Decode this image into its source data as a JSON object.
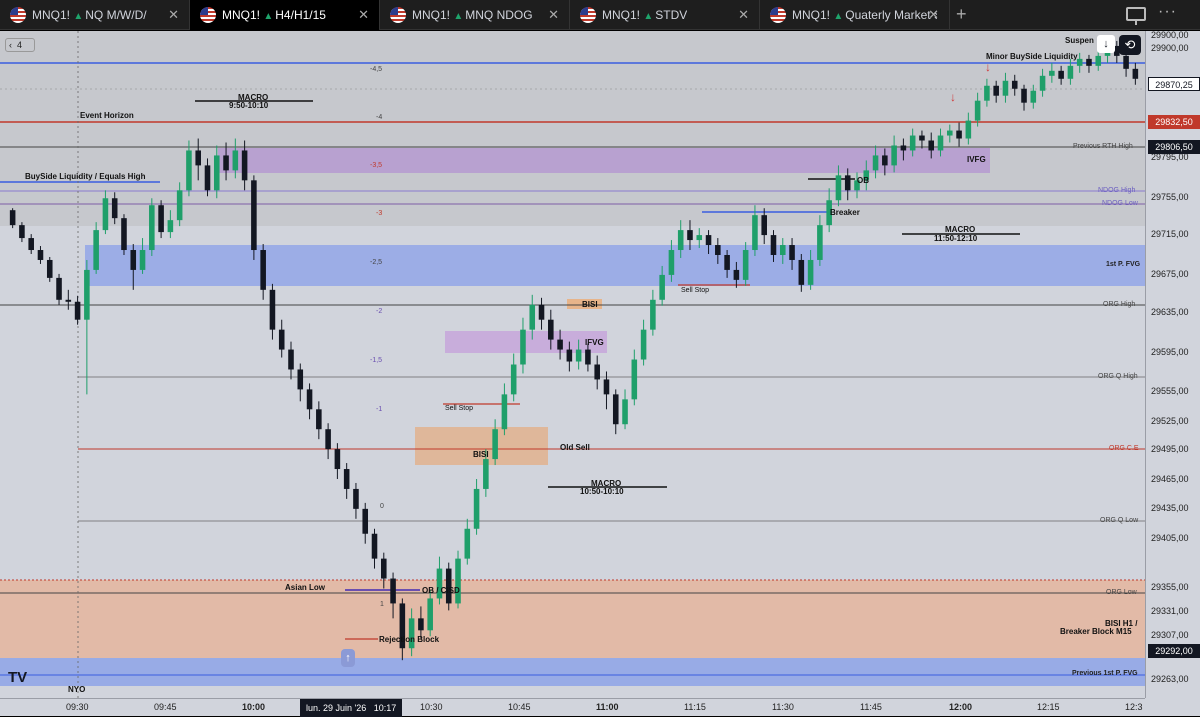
{
  "tabs": [
    {
      "symbol": "MNQ1!",
      "name": "NQ M/W/D/",
      "active": false
    },
    {
      "symbol": "MNQ1!",
      "name": "H4/H1/15",
      "active": true
    },
    {
      "symbol": "MNQ1!",
      "name": "MNQ NDOG",
      "active": false
    },
    {
      "symbol": "MNQ1!",
      "name": "STDV",
      "active": false
    },
    {
      "symbol": "MNQ1!",
      "name": "Quaterly Market S",
      "active": false
    }
  ],
  "toolbar": {
    "zoom_value": "4",
    "suspend_label": "Suspen"
  },
  "price_axis": {
    "ticks": [
      "29900,00",
      "29795,00",
      "29755,00",
      "29715,00",
      "29675,00",
      "29635,00",
      "29595,00",
      "29555,00",
      "29525,00",
      "29495,00",
      "29465,00",
      "29435,00",
      "29405,00",
      "29355,00",
      "29331,00",
      "29307,00",
      "29263,00"
    ],
    "current_price": "29870,25",
    "red_tag": "29832,50",
    "dark_tag": "29806,50",
    "bottom_tag": "29292,00"
  },
  "time_axis": {
    "labels": [
      "09:30",
      "09:45",
      "10:00",
      "10:30",
      "10:45",
      "11:00",
      "11:15",
      "11:30",
      "11:45",
      "12:00",
      "12:15",
      "12:3"
    ],
    "date_label": "lun. 29 Juin '26",
    "time_label": "10:17"
  },
  "annotations": {
    "macro1_title": "MACRO",
    "macro1_time": "9:50-10:10",
    "macro2_title": "MACRO",
    "macro2_time": "11:50-12:10",
    "macro3_title": "MACRO",
    "macro3_time": "10:50-10:10",
    "event_horizon": "Event Horizon",
    "buyside": "BuySide Liquidity / Equals High",
    "minor_buyside": "Minor BuySide Liquidity",
    "ivfg": "IVFG",
    "ob": "OB",
    "breaker": "Breaker",
    "sell_stop_1": "Sell Stop",
    "sell_stop_2": "Sell Stop",
    "bisi_1": "BISI",
    "bisi_2": "BISI",
    "ifvg": "IFVG",
    "old_sell": "Old Sell",
    "asian_low": "Asian Low",
    "ob_cisd": "OB / CISD",
    "rejection_block": "Rejection Block",
    "bisi_h1_1": "BISI H1 /",
    "bisi_h1_2": "Breaker Block M15",
    "nyo": "NYO"
  },
  "levels": {
    "prev_rth_high": "Previous RTH High",
    "ndog_high": "NDOG High",
    "ndog_low": "NDOG Low",
    "first_fvg": "1st P. FVG",
    "org_high": "ORG  High",
    "org_q_high": "ORG Q High",
    "org_ce": "ORG C.E",
    "org_q_low": "ORG Q Low",
    "org_low": "ORG Low",
    "prev_first_fvg": "Previous 1st P. FVG"
  },
  "fib": [
    "-4,5",
    "-4",
    "-3,5",
    "-3",
    "-2,5",
    "-2",
    "-1,5",
    "-1",
    "0",
    "1"
  ],
  "colors": {
    "bg": "#d1d4dc",
    "up": "#1f9f6a",
    "down": "#131722",
    "purple_zone": "#b59ad0",
    "blue_zone": "#8ea3e8",
    "orange_zone": "#e7b48a",
    "red_line": "#c0392b",
    "blue_line": "#3a5ee0"
  },
  "candles": [
    [
      29740,
      29725,
      29742,
      29722
    ],
    [
      29725,
      29712,
      29728,
      29708
    ],
    [
      29712,
      29700,
      29716,
      29696
    ],
    [
      29700,
      29690,
      29704,
      29686
    ],
    [
      29690,
      29672,
      29693,
      29668
    ],
    [
      29672,
      29650,
      29676,
      29645
    ],
    [
      29650,
      29648,
      29660,
      29640
    ],
    [
      29648,
      29630,
      29654,
      29625
    ],
    [
      29630,
      29680,
      29690,
      29555
    ],
    [
      29680,
      29720,
      29728,
      29676
    ],
    [
      29720,
      29752,
      29760,
      29716
    ],
    [
      29752,
      29732,
      29758,
      29726
    ],
    [
      29732,
      29700,
      29736,
      29695
    ],
    [
      29700,
      29680,
      29706,
      29660
    ],
    [
      29680,
      29700,
      29712,
      29676
    ],
    [
      29700,
      29745,
      29752,
      29694
    ],
    [
      29745,
      29718,
      29750,
      29712
    ],
    [
      29718,
      29730,
      29740,
      29712
    ],
    [
      29730,
      29760,
      29768,
      29724
    ],
    [
      29760,
      29800,
      29810,
      29754
    ],
    [
      29800,
      29785,
      29812,
      29770
    ],
    [
      29785,
      29760,
      29792,
      29754
    ],
    [
      29760,
      29795,
      29805,
      29752
    ],
    [
      29795,
      29780,
      29808,
      29770
    ],
    [
      29780,
      29800,
      29812,
      29772
    ],
    [
      29800,
      29770,
      29810,
      29760
    ],
    [
      29770,
      29700,
      29775,
      29690
    ],
    [
      29700,
      29660,
      29706,
      29650
    ],
    [
      29660,
      29620,
      29666,
      29610
    ],
    [
      29620,
      29600,
      29630,
      29592
    ],
    [
      29600,
      29580,
      29608,
      29570
    ],
    [
      29580,
      29560,
      29586,
      29548
    ],
    [
      29560,
      29540,
      29566,
      29530
    ],
    [
      29540,
      29520,
      29548,
      29510
    ],
    [
      29520,
      29500,
      29526,
      29490
    ],
    [
      29500,
      29480,
      29506,
      29470
    ],
    [
      29480,
      29460,
      29486,
      29450
    ],
    [
      29460,
      29440,
      29466,
      29430
    ],
    [
      29440,
      29415,
      29446,
      29405
    ],
    [
      29415,
      29390,
      29420,
      29380
    ],
    [
      29390,
      29370,
      29396,
      29360
    ],
    [
      29370,
      29345,
      29376,
      29330
    ],
    [
      29345,
      29300,
      29350,
      29288
    ],
    [
      29300,
      29330,
      29340,
      29292
    ],
    [
      29330,
      29318,
      29342,
      29310
    ],
    [
      29318,
      29350,
      29358,
      29312
    ],
    [
      29350,
      29380,
      29392,
      29344
    ],
    [
      29380,
      29345,
      29386,
      29338
    ],
    [
      29345,
      29390,
      29398,
      29340
    ],
    [
      29390,
      29420,
      29430,
      29384
    ],
    [
      29420,
      29460,
      29470,
      29414
    ],
    [
      29460,
      29490,
      29500,
      29452
    ],
    [
      29490,
      29520,
      29530,
      29484
    ],
    [
      29520,
      29555,
      29566,
      29514
    ],
    [
      29555,
      29585,
      29596,
      29548
    ],
    [
      29585,
      29620,
      29632,
      29576
    ],
    [
      29620,
      29645,
      29655,
      29610
    ],
    [
      29645,
      29630,
      29652,
      29620
    ],
    [
      29630,
      29610,
      29640,
      29600
    ],
    [
      29610,
      29600,
      29620,
      29590
    ],
    [
      29600,
      29588,
      29608,
      29578
    ],
    [
      29588,
      29600,
      29610,
      29580
    ],
    [
      29600,
      29585,
      29606,
      29578
    ],
    [
      29585,
      29570,
      29594,
      29560
    ],
    [
      29570,
      29555,
      29578,
      29540
    ],
    [
      29555,
      29525,
      29560,
      29515
    ],
    [
      29525,
      29550,
      29560,
      29520
    ],
    [
      29550,
      29590,
      29600,
      29544
    ],
    [
      29590,
      29620,
      29630,
      29584
    ],
    [
      29620,
      29650,
      29660,
      29614
    ],
    [
      29650,
      29675,
      29684,
      29644
    ],
    [
      29675,
      29700,
      29710,
      29668
    ],
    [
      29700,
      29720,
      29730,
      29692
    ],
    [
      29720,
      29710,
      29730,
      29700
    ],
    [
      29710,
      29715,
      29722,
      29702
    ],
    [
      29715,
      29705,
      29720,
      29696
    ],
    [
      29705,
      29695,
      29712,
      29686
    ],
    [
      29695,
      29680,
      29700,
      29672
    ],
    [
      29680,
      29670,
      29688,
      29662
    ],
    [
      29670,
      29700,
      29708,
      29664
    ],
    [
      29700,
      29735,
      29745,
      29694
    ],
    [
      29735,
      29715,
      29742,
      29706
    ],
    [
      29715,
      29695,
      29720,
      29688
    ],
    [
      29695,
      29705,
      29712,
      29686
    ],
    [
      29705,
      29690,
      29712,
      29680
    ],
    [
      29690,
      29665,
      29696,
      29658
    ],
    [
      29665,
      29690,
      29700,
      29660
    ],
    [
      29690,
      29725,
      29735,
      29684
    ],
    [
      29725,
      29750,
      29762,
      29718
    ],
    [
      29750,
      29775,
      29785,
      29744
    ],
    [
      29775,
      29760,
      29782,
      29750
    ],
    [
      29760,
      29770,
      29778,
      29752
    ],
    [
      29770,
      29780,
      29790,
      29760
    ],
    [
      29780,
      29795,
      29805,
      29772
    ],
    [
      29795,
      29785,
      29802,
      29775
    ],
    [
      29785,
      29805,
      29815,
      29778
    ],
    [
      29805,
      29800,
      29812,
      29790
    ],
    [
      29800,
      29815,
      29822,
      29794
    ],
    [
      29815,
      29810,
      29820,
      29802
    ],
    [
      29810,
      29800,
      29818,
      29792
    ],
    [
      29800,
      29815,
      29822,
      29794
    ],
    [
      29815,
      29820,
      29826,
      29808
    ],
    [
      29820,
      29812,
      29828,
      29804
    ],
    [
      29812,
      29830,
      29838,
      29806
    ],
    [
      29830,
      29850,
      29858,
      29824
    ],
    [
      29850,
      29865,
      29872,
      29844
    ],
    [
      29865,
      29855,
      29870,
      29848
    ],
    [
      29855,
      29870,
      29878,
      29848
    ],
    [
      29870,
      29862,
      29876,
      29855
    ],
    [
      29862,
      29848,
      29866,
      29840
    ],
    [
      29848,
      29860,
      29866,
      29842
    ],
    [
      29860,
      29875,
      29882,
      29854
    ],
    [
      29875,
      29880,
      29888,
      29868
    ],
    [
      29880,
      29872,
      29885,
      29866
    ],
    [
      29872,
      29885,
      29892,
      29866
    ],
    [
      29885,
      29892,
      29898,
      29878
    ],
    [
      29892,
      29885,
      29896,
      29878
    ],
    [
      29885,
      29895,
      29900,
      29880
    ],
    [
      29895,
      29905,
      29912,
      29888
    ],
    [
      29905,
      29895,
      29910,
      29888
    ],
    [
      29895,
      29882,
      29900,
      29874
    ],
    [
      29882,
      29872,
      29888,
      29866
    ]
  ]
}
